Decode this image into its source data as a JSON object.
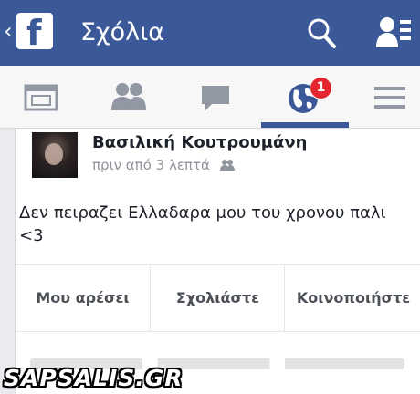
{
  "header": {
    "title": "Σχόλια",
    "back_icon": "chevron-left-icon",
    "logo_icon": "facebook-logo-icon",
    "search_icon": "search-icon",
    "friend_requests_icon": "friend-requests-icon",
    "background_color": "#3b5998"
  },
  "tabs": [
    {
      "name": "news-feed",
      "icon": "news-feed-icon",
      "active": false
    },
    {
      "name": "friends",
      "icon": "friends-icon",
      "active": false
    },
    {
      "name": "messages",
      "icon": "chat-bubble-icon",
      "active": false
    },
    {
      "name": "notifications",
      "icon": "globe-icon",
      "active": true,
      "badge": "1"
    },
    {
      "name": "more",
      "icon": "menu-icon",
      "active": false
    }
  ],
  "post": {
    "author": "Βασιλική Κουτρουμάνη",
    "time": "πριν από 3 λεπτά",
    "audience_icon": "friends-audience-icon",
    "text": "Δεν πειραζει Ελλαδαρα μου του χρονου παλι <3"
  },
  "actions": {
    "like": "Μου αρέσει",
    "comment": "Σχολιάστε",
    "share": "Κοινοποιήστε"
  },
  "watermark": "SAPSALIS.GR",
  "colors": {
    "brand_blue": "#3b5998",
    "badge_red": "#e3262e",
    "muted_text": "#90949c"
  }
}
